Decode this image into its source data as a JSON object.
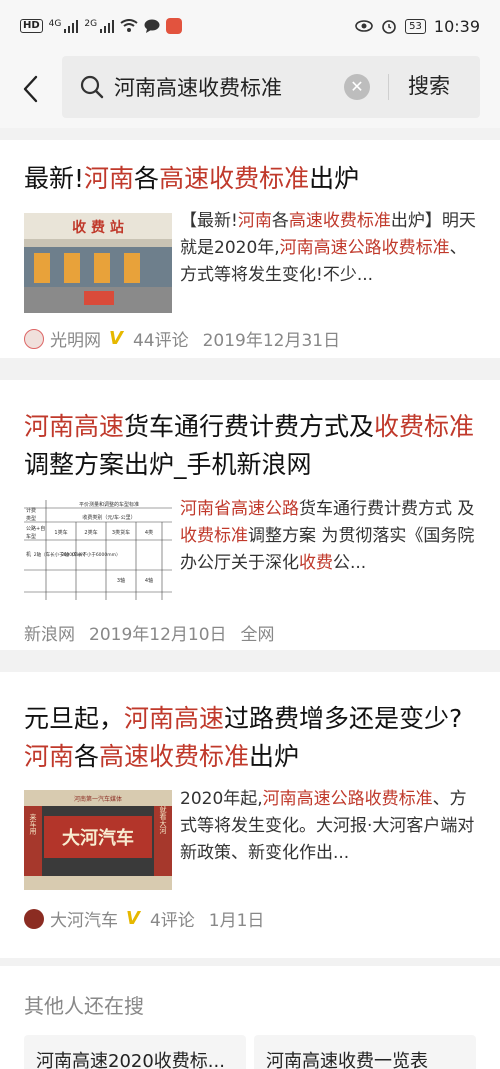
{
  "status": {
    "hd": "HD",
    "sig1_tag": "4G",
    "sig2_tag": "2G",
    "battery": "53",
    "time": "10:39"
  },
  "search": {
    "query": "河南高速收费标准",
    "button": "搜索"
  },
  "results": [
    {
      "title": [
        [
          "最新!",
          ""
        ],
        [
          "河南",
          "hl"
        ],
        [
          "各",
          ""
        ],
        [
          "高速收费标准",
          "hl"
        ],
        [
          "出炉",
          ""
        ]
      ],
      "snippet": [
        [
          "【最新!",
          ""
        ],
        [
          "河南",
          "hl"
        ],
        [
          "各",
          ""
        ],
        [
          "高速收费标准",
          "hl"
        ],
        [
          "出炉】明天就是2020年,",
          ""
        ],
        [
          "河南高速公路收费标准",
          "hl"
        ],
        [
          "、方式等将发生变化!不少...",
          ""
        ]
      ],
      "thumb_text": "收 费 站",
      "source": "光明网",
      "verified": "V",
      "comments": "44评论",
      "date": "2019年12月31日"
    },
    {
      "title": [
        [
          "河南高速",
          "hl"
        ],
        [
          "货车通行费计费方式及",
          ""
        ],
        [
          "收费标准",
          "hl"
        ],
        [
          "调整方案出炉_手机新浪网",
          ""
        ]
      ],
      "snippet": [
        [
          "河南省高速公路",
          "hl"
        ],
        [
          "货车通行费计费方式 及",
          ""
        ],
        [
          "收费标准",
          "hl"
        ],
        [
          "调整方案 为贯彻落实《国务院办公厅关于深化",
          ""
        ],
        [
          "收费",
          "hl"
        ],
        [
          "公...",
          ""
        ]
      ],
      "thumb_table": {
        "header": "平价测量和调整的车型标准",
        "sub": "收费类别（元/车·公里）",
        "cols": [
          "1类车",
          "2类车",
          "3类货车",
          "4类"
        ],
        "row": [
          "2轴（车长小于6000mm）",
          "2轴（车长不小于6000mm）",
          "3轴",
          "4轴"
        ],
        "left": [
          "计费",
          "类型",
          "公路+自",
          "车型",
          "机"
        ]
      },
      "source": "新浪网",
      "date": "2019年12月10日",
      "scope": "全网"
    },
    {
      "title": [
        [
          "元旦起，",
          ""
        ],
        [
          "河南高速",
          "hl"
        ],
        [
          "过路费增多还是变少?",
          ""
        ],
        [
          "河南",
          "hl"
        ],
        [
          "各",
          ""
        ],
        [
          "高速收费标准",
          "hl"
        ],
        [
          "出炉",
          ""
        ]
      ],
      "snippet": [
        [
          "2020年起,",
          ""
        ],
        [
          "河南高速公路收费标准",
          "hl"
        ],
        [
          "、方式等将发生变化。大河报·大河客户端对新政策、新变化作出...",
          ""
        ]
      ],
      "thumb_banner": "大河汽车",
      "thumb_top": "河南第一汽车媒体",
      "thumb_left": "来车用",
      "thumb_right": "就看大河",
      "source": "大河汽车",
      "verified": "V",
      "comments": "4评论",
      "date": "1月1日"
    }
  ],
  "related": {
    "heading": "其他人还在搜",
    "items": [
      "河南高速2020收费标...",
      "河南高速收费一览表"
    ]
  }
}
